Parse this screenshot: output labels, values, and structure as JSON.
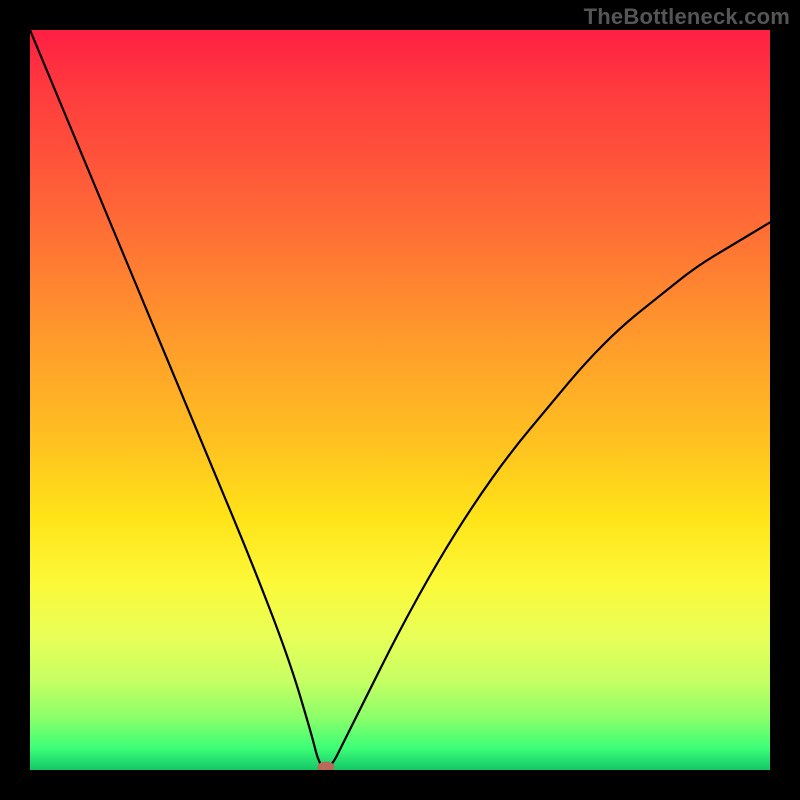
{
  "watermark": "TheBottleneck.com",
  "chart_data": {
    "type": "line",
    "title": "",
    "xlabel": "",
    "ylabel": "",
    "xlim": [
      0,
      100
    ],
    "ylim": [
      0,
      100
    ],
    "grid": false,
    "legend": false,
    "series": [
      {
        "name": "bottleneck-curve",
        "x": [
          0,
          5,
          10,
          15,
          20,
          25,
          30,
          35,
          38,
          39,
          40,
          41,
          42,
          45,
          50,
          55,
          60,
          65,
          70,
          75,
          80,
          85,
          90,
          95,
          100
        ],
        "y": [
          100,
          88,
          76,
          64,
          52,
          40,
          28,
          15,
          5,
          1,
          0,
          1,
          3,
          9,
          19,
          28,
          36,
          43,
          49,
          55,
          60,
          64,
          68,
          71,
          74
        ]
      }
    ],
    "annotations": [
      {
        "name": "minimum-marker",
        "x": 40,
        "y": 0
      }
    ]
  },
  "colors": {
    "background_frame": "#000000",
    "gradient_top": "#ff1f44",
    "gradient_mid": "#ffe418",
    "gradient_bottom": "#14c76a",
    "curve": "#000000",
    "marker": "#b96a5a",
    "watermark": "#555555"
  }
}
